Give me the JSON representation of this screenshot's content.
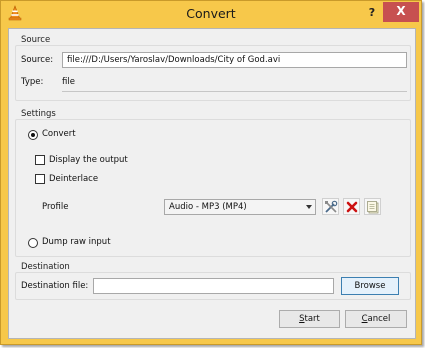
{
  "window": {
    "title": "Convert",
    "help_label": "?",
    "close_label": "X"
  },
  "source": {
    "group_label": "Source",
    "source_label": "Source:",
    "source_value": "file:///D:/Users/Yaroslav/Downloads/City of God.avi",
    "type_label": "Type:",
    "type_value": "file"
  },
  "settings": {
    "group_label": "Settings",
    "convert_label": "Convert",
    "convert_selected": true,
    "display_output_label": "Display the output",
    "display_output_checked": false,
    "deinterlace_label": "Deinterlace",
    "deinterlace_checked": false,
    "profile_label": "Profile",
    "profile_value": "Audio - MP3 (MP4)",
    "dump_raw_label": "Dump raw input",
    "dump_raw_selected": false
  },
  "destination": {
    "group_label": "Destination",
    "file_label": "Destination file:",
    "file_value": "",
    "browse_label": "Browse"
  },
  "actions": {
    "start_first": "S",
    "start_rest": "tart",
    "cancel_first": "C",
    "cancel_rest": "ancel"
  },
  "colors": {
    "title_bar": "#f7c84a",
    "close_button": "#c75050",
    "delete_icon": "#cc1111",
    "focus_border": "#3c7fb1"
  }
}
